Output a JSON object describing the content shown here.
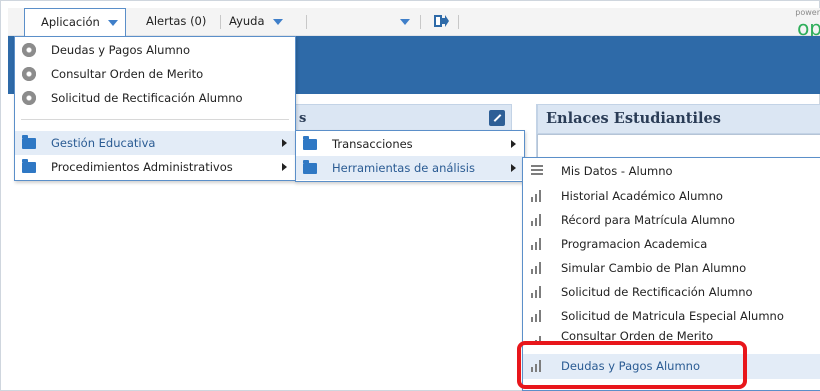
{
  "menubar": {
    "app_label": "Aplicación",
    "alerts_label": "Alertas (0)",
    "help_label": "Ayuda",
    "brand_small": "power",
    "brand": "op"
  },
  "portlets": {
    "left_title_fragment": "s",
    "right_title": "Enlaces Estudiantiles"
  },
  "menu1": {
    "items": [
      {
        "label": "Deudas y Pagos Alumno",
        "icon": "gear-icon"
      },
      {
        "label": "Consultar Orden de Merito",
        "icon": "gear-icon"
      },
      {
        "label": "Solicitud de Rectificación Alumno",
        "icon": "gear-icon"
      }
    ],
    "folders": [
      {
        "label": "Gestión Educativa",
        "icon": "folder-icon",
        "selected": true
      },
      {
        "label": "Procedimientos Administrativos",
        "icon": "folder-icon",
        "selected": false
      }
    ]
  },
  "menu2": {
    "items": [
      {
        "label": "Transacciones",
        "icon": "folder-icon",
        "selected": false
      },
      {
        "label": "Herramientas de análisis",
        "icon": "folder-icon",
        "selected": true
      }
    ]
  },
  "menu3": {
    "items": [
      {
        "label": "Mis Datos - Alumno",
        "icon": "list-icon"
      },
      {
        "label": "Historial Académico Alumno",
        "icon": "bar-chart-icon"
      },
      {
        "label": "Récord para Matrícula Alumno",
        "icon": "bar-chart-icon"
      },
      {
        "label": "Programacion Academica",
        "icon": "bar-chart-icon"
      },
      {
        "label": "Simular Cambio de Plan Alumno",
        "icon": "bar-chart-icon"
      },
      {
        "label": "Solicitud de Rectificación Alumno",
        "icon": "bar-chart-icon"
      },
      {
        "label": "Solicitud de Matricula Especial Alumno",
        "icon": "bar-chart-icon"
      },
      {
        "label": "Consultar Orden de Merito",
        "icon": "bar-chart-icon"
      },
      {
        "label": "Deudas y Pagos Alumno",
        "icon": "bar-chart-icon"
      }
    ]
  },
  "colors": {
    "accent": "#2e6aa8",
    "highlight": "#e8161b",
    "brand": "#2fae5b"
  }
}
